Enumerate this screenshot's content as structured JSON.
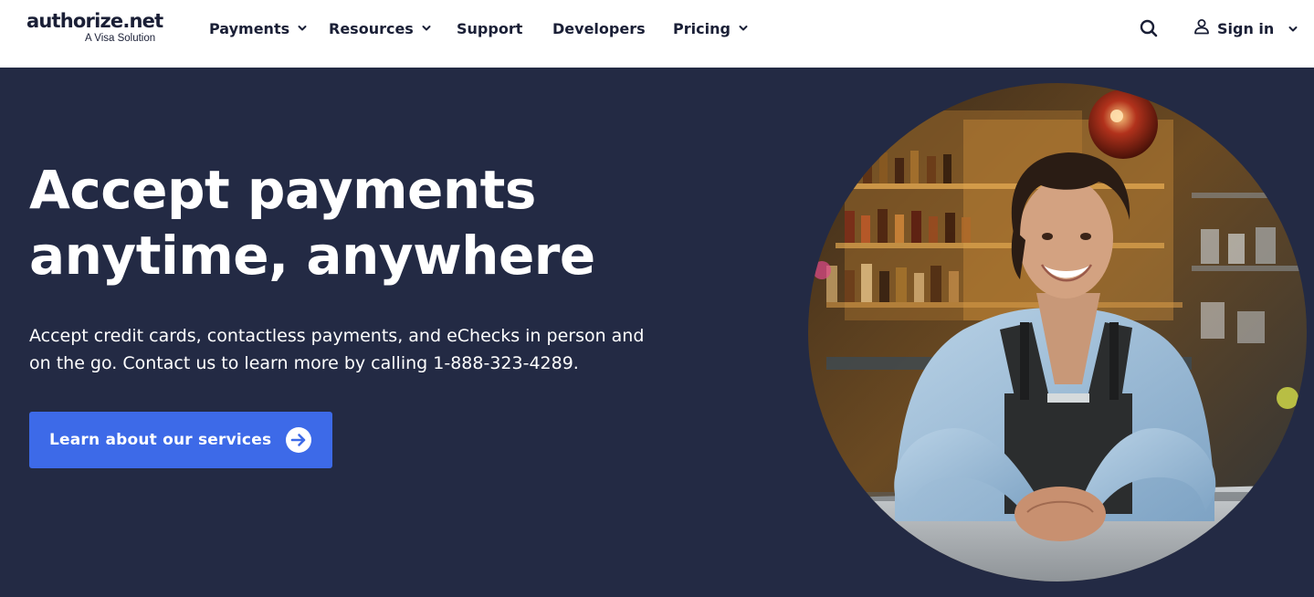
{
  "brand": {
    "name": "authorize.net",
    "tagline": "A Visa Solution"
  },
  "nav": {
    "items": [
      {
        "label": "Payments",
        "has_dropdown": true
      },
      {
        "label": "Resources",
        "has_dropdown": true
      },
      {
        "label": "Support",
        "has_dropdown": false
      },
      {
        "label": "Developers",
        "has_dropdown": false
      },
      {
        "label": "Pricing",
        "has_dropdown": true
      }
    ],
    "search_icon": "search-icon",
    "signin_label": "Sign in",
    "signin_icon": "user-icon"
  },
  "hero": {
    "title_line1": "Accept payments",
    "title_line2": "anytime, anywhere",
    "subtitle": "Accept credit cards, contactless payments, and eChecks in person and on the go. Contact us to learn more by calling 1-888-323-4289.",
    "cta_label": "Learn about our services",
    "cta_icon": "arrow-right-circle-icon",
    "image": "smiling-woman-in-apron-at-bar-counter"
  },
  "colors": {
    "header_bg": "#ffffff",
    "hero_bg": "#232a44",
    "text_dark": "#1a1f36",
    "cta_bg": "#3d6ae8",
    "logo_accent": "#82b541"
  }
}
